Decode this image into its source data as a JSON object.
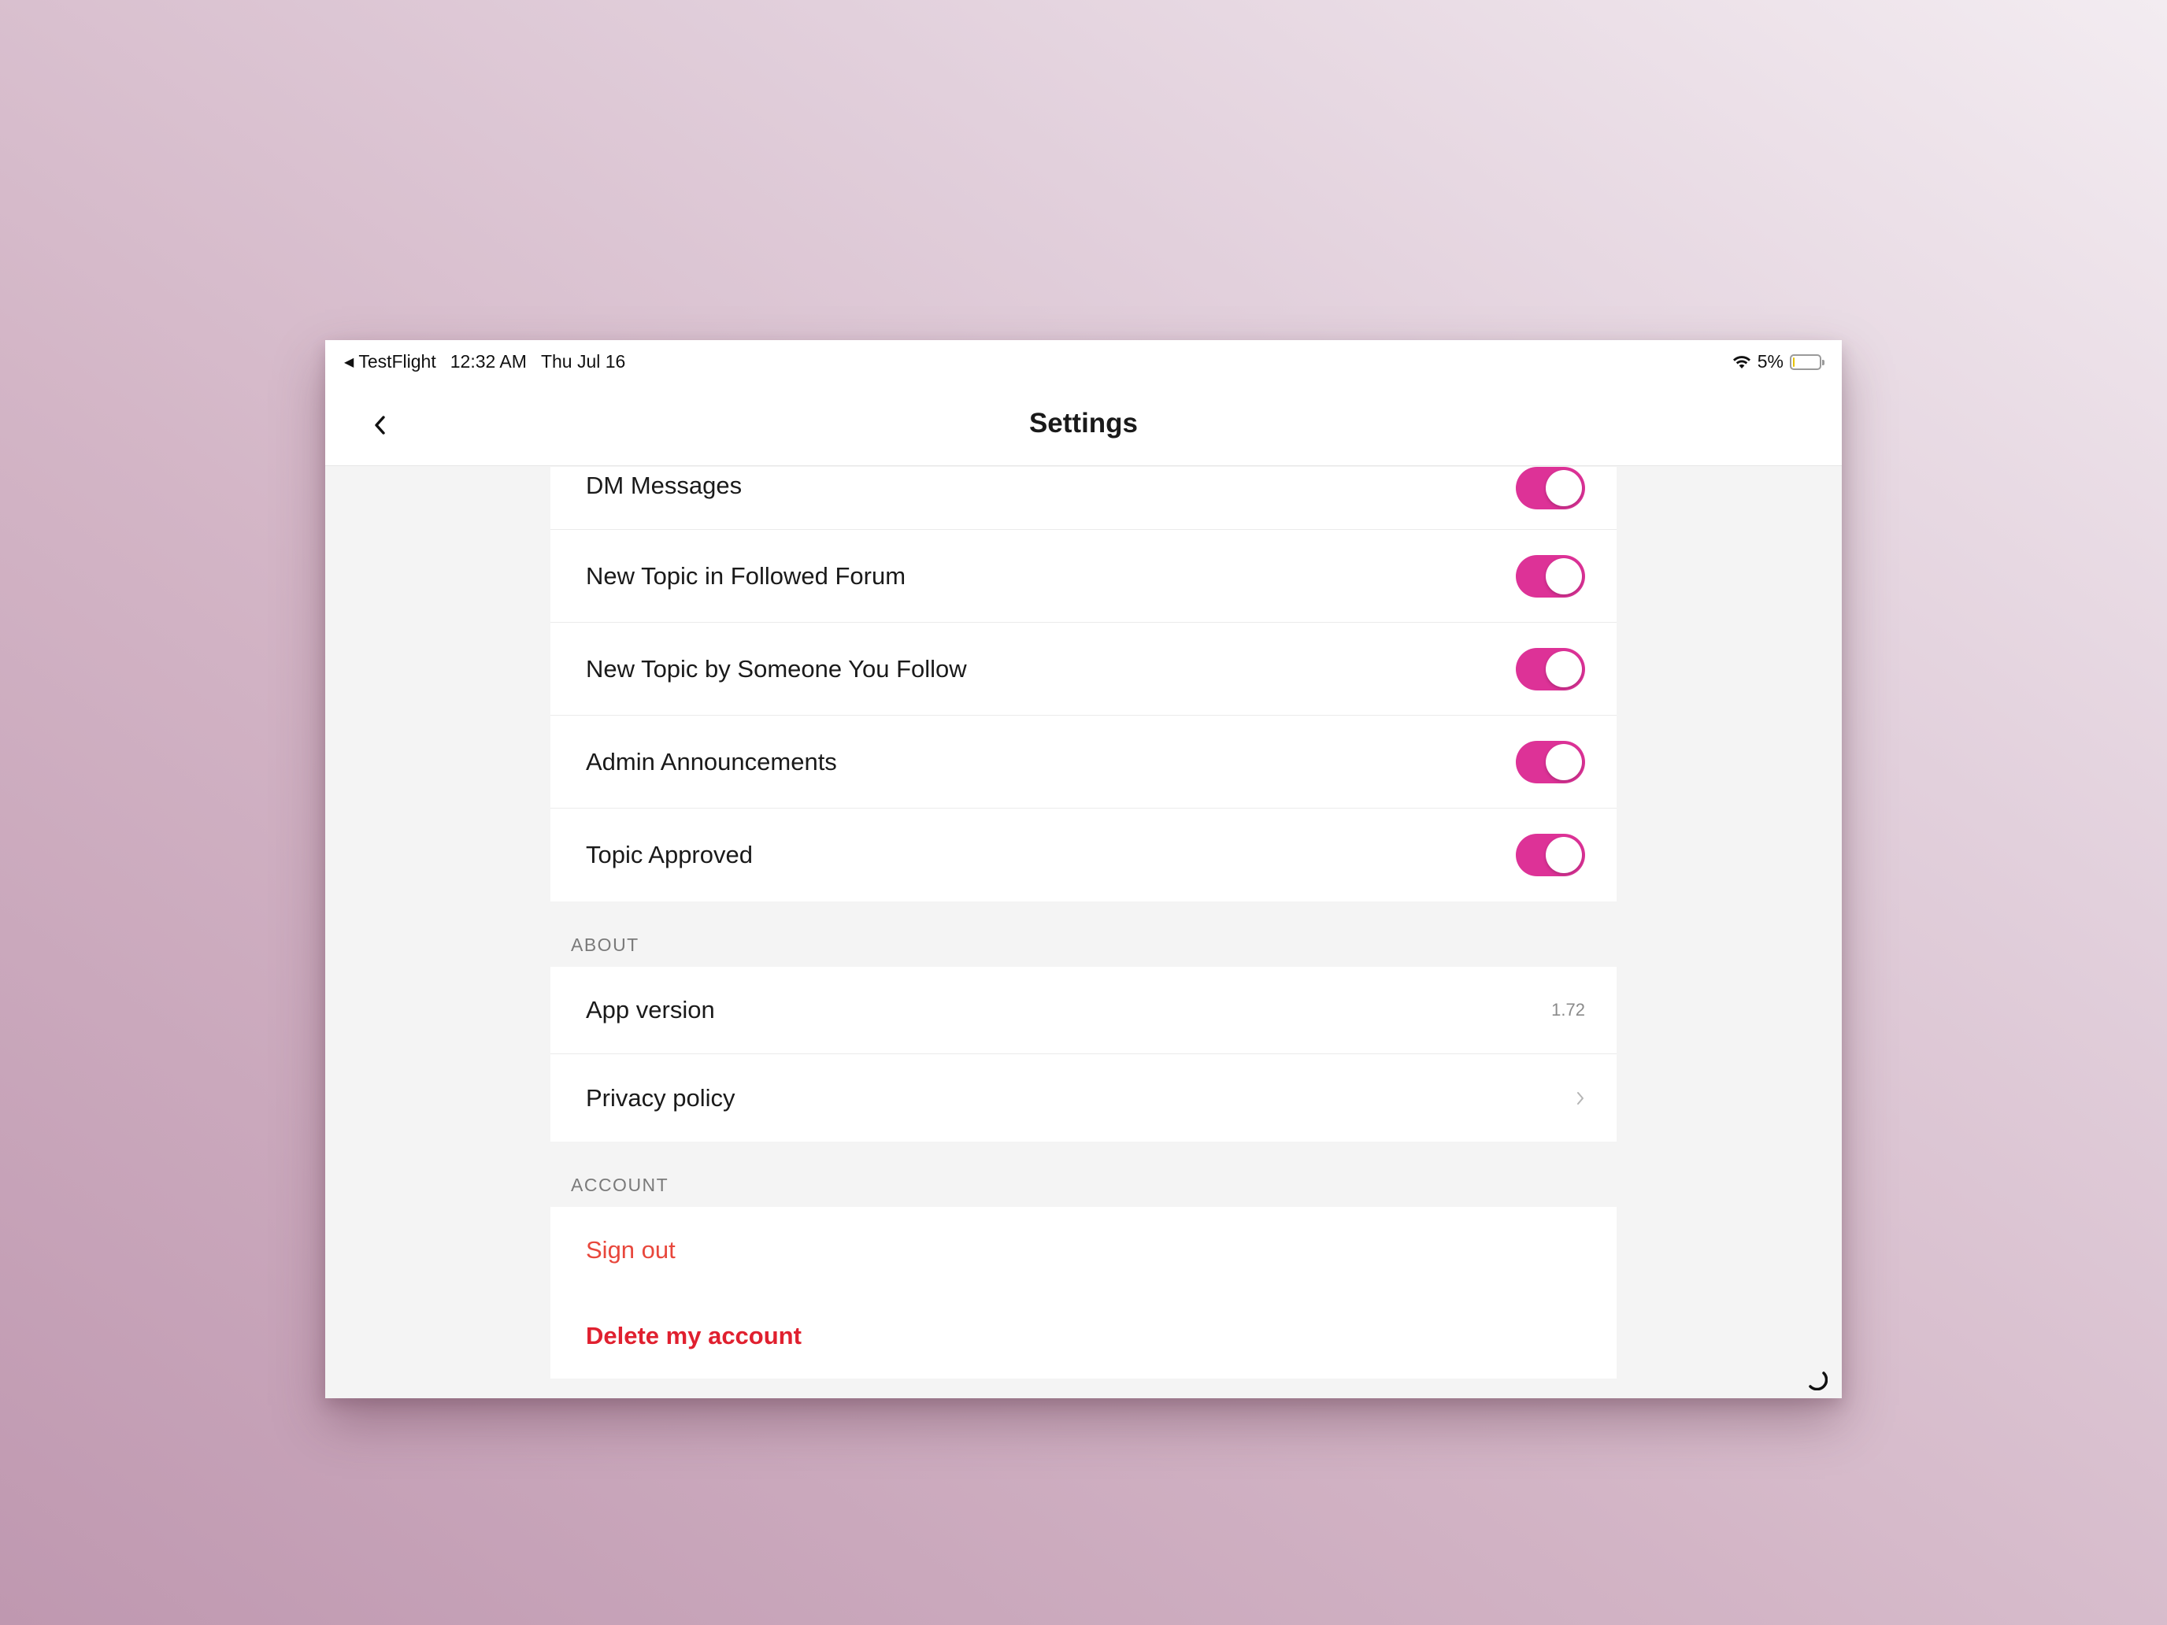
{
  "status_bar": {
    "back_app": "TestFlight",
    "time": "12:32 AM",
    "date": "Thu Jul 16",
    "battery_percent": "5%",
    "battery_level": 0.05,
    "icons": [
      "wifi-icon",
      "battery-icon"
    ]
  },
  "nav": {
    "title": "Settings",
    "back_icon": "chevron-left-icon"
  },
  "notifications": {
    "items": [
      {
        "label": "DM Messages",
        "enabled": true
      },
      {
        "label": "New Topic in Followed Forum",
        "enabled": true
      },
      {
        "label": "New Topic by Someone You Follow",
        "enabled": true
      },
      {
        "label": "Admin Announcements",
        "enabled": true
      },
      {
        "label": "Topic Approved",
        "enabled": true
      }
    ]
  },
  "about": {
    "header": "ABOUT",
    "app_version_label": "App version",
    "app_version_value": "1.72",
    "privacy_label": "Privacy policy",
    "privacy_icon": "chevron-right-icon"
  },
  "account": {
    "header": "ACCOUNT",
    "sign_out": "Sign out",
    "delete": "Delete my account"
  },
  "colors": {
    "accent": "#dd3297",
    "sign_out": "#e8473c",
    "delete": "#e0202f"
  }
}
